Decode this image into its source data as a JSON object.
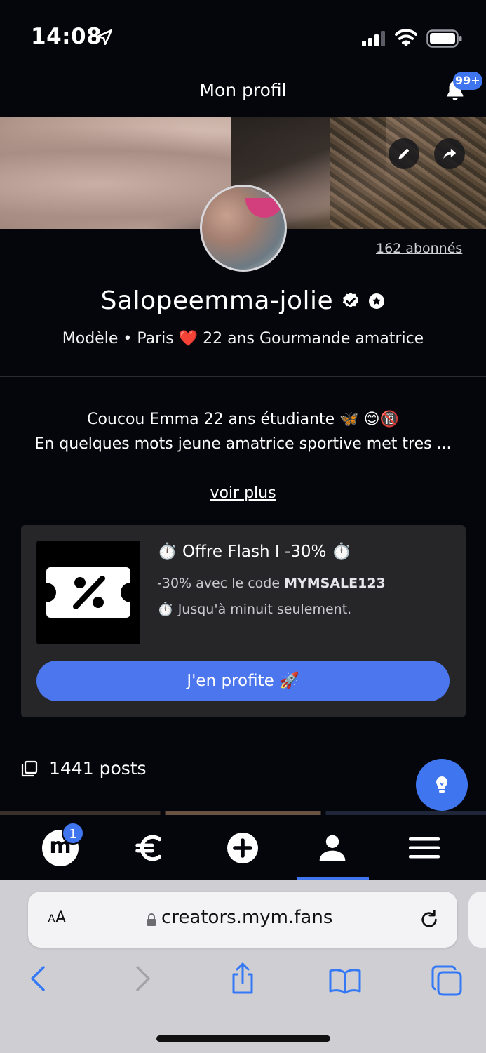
{
  "status": {
    "time": "14:08"
  },
  "header": {
    "title": "Mon profil",
    "notifications": "99+"
  },
  "profile": {
    "followers": "162 abonnés",
    "name": "Salopeemma-jolie",
    "tagline": "Modèle • Paris ❤️ 22 ans Gourmande amatrice",
    "bio_line1": "Coucou Emma 22 ans étudiante 🦋 😊🔞",
    "bio_line2": "En quelques mots jeune amatrice sportive met tres ...",
    "see_more": "voir plus"
  },
  "promo": {
    "title": "⏱️ Offre Flash I -30% ⏱️",
    "line1_prefix": "-30% avec le code ",
    "code": "MYMSALE123",
    "line2": "⏱️ Jusqu'à minuit seulement.",
    "cta": "J'en profite 🚀"
  },
  "posts": {
    "count_label": "1441 posts"
  },
  "tabbar": {
    "messages_letter": "m",
    "messages_badge": "1",
    "active_tab": "profile"
  },
  "browser": {
    "aa_small": "A",
    "aa_large": "A",
    "url": "creators.mym.fans"
  },
  "colors": {
    "accent": "#3f75ee",
    "background": "#05050c",
    "card": "#262629"
  }
}
